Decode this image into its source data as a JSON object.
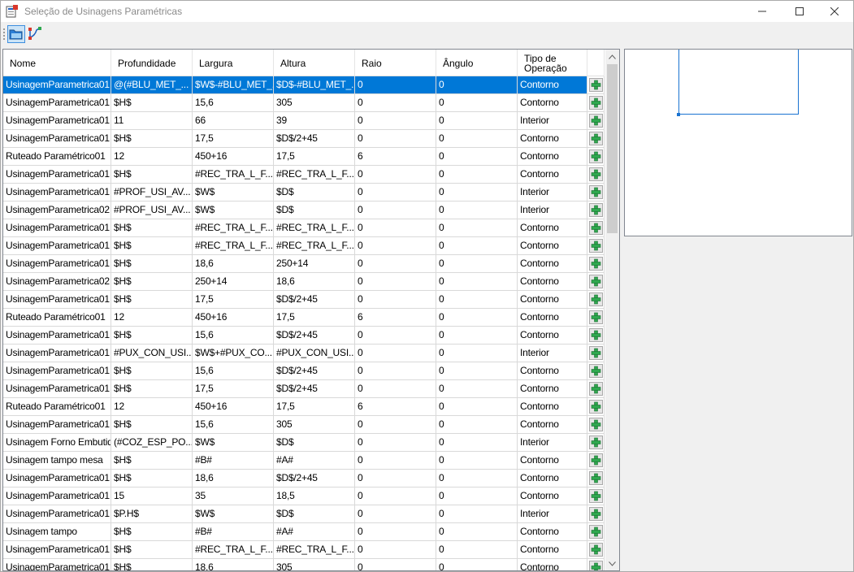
{
  "window": {
    "title": "Seleção de Usinagens Paramétricas"
  },
  "toolbar": {
    "items": [
      {
        "icon": "folder-view-icon"
      },
      {
        "icon": "path-edit-icon"
      }
    ]
  },
  "grid": {
    "columns": [
      "Nome",
      "Profundidade",
      "Largura",
      "Altura",
      "Raio",
      "Ângulo",
      "Tipo de\nOperação"
    ],
    "rows": [
      [
        "UsinagemParametrica01",
        "@(#BLU_MET_...",
        "$W$-#BLU_MET_...",
        "$D$-#BLU_MET_...",
        "0",
        "0",
        "Contorno"
      ],
      [
        "UsinagemParametrica01",
        "$H$",
        "15,6",
        "305",
        "0",
        "0",
        "Contorno"
      ],
      [
        "UsinagemParametrica01",
        "11",
        "66",
        "39",
        "0",
        "0",
        "Interior"
      ],
      [
        "UsinagemParametrica01",
        "$H$",
        "17,5",
        "$D$/2+45",
        "0",
        "0",
        "Contorno"
      ],
      [
        "Ruteado Paramétrico01",
        "12",
        "450+16",
        "17,5",
        "6",
        "0",
        "Contorno"
      ],
      [
        "UsinagemParametrica01",
        "$H$",
        "#REC_TRA_L_F...",
        "#REC_TRA_L_F...",
        "0",
        "0",
        "Contorno"
      ],
      [
        "UsinagemParametrica01",
        "#PROF_USI_AV...",
        "$W$",
        "$D$",
        "0",
        "0",
        "Interior"
      ],
      [
        "UsinagemParametrica02",
        "#PROF_USI_AV...",
        "$W$",
        "$D$",
        "0",
        "0",
        "Interior"
      ],
      [
        "UsinagemParametrica01",
        "$H$",
        "#REC_TRA_L_F...",
        "#REC_TRA_L_F...",
        "0",
        "0",
        "Contorno"
      ],
      [
        "UsinagemParametrica01",
        "$H$",
        "#REC_TRA_L_F...",
        "#REC_TRA_L_F...",
        "0",
        "0",
        "Contorno"
      ],
      [
        "UsinagemParametrica01",
        "$H$",
        "18,6",
        "250+14",
        "0",
        "0",
        "Contorno"
      ],
      [
        "UsinagemParametrica02",
        "$H$",
        "250+14",
        "18,6",
        "0",
        "0",
        "Contorno"
      ],
      [
        "UsinagemParametrica01",
        "$H$",
        "17,5",
        "$D$/2+45",
        "0",
        "0",
        "Contorno"
      ],
      [
        "Ruteado Paramétrico01",
        "12",
        "450+16",
        "17,5",
        "6",
        "0",
        "Contorno"
      ],
      [
        "UsinagemParametrica01",
        "$H$",
        "15,6",
        "$D$/2+45",
        "0",
        "0",
        "Contorno"
      ],
      [
        "UsinagemParametrica01",
        "#PUX_CON_USI...",
        "$W$+#PUX_CO...",
        "#PUX_CON_USI...",
        "0",
        "0",
        "Interior"
      ],
      [
        "UsinagemParametrica01",
        "$H$",
        "15,6",
        "$D$/2+45",
        "0",
        "0",
        "Contorno"
      ],
      [
        "UsinagemParametrica01",
        "$H$",
        "17,5",
        "$D$/2+45",
        "0",
        "0",
        "Contorno"
      ],
      [
        "Ruteado Paramétrico01",
        "12",
        "450+16",
        "17,5",
        "6",
        "0",
        "Contorno"
      ],
      [
        "UsinagemParametrica01",
        "$H$",
        "15,6",
        "305",
        "0",
        "0",
        "Contorno"
      ],
      [
        "Usinagem Forno Embutido",
        "(#COZ_ESP_PO...",
        "$W$",
        "$D$",
        "0",
        "0",
        "Interior"
      ],
      [
        "Usinagem tampo mesa",
        "$H$",
        "#B#",
        "#A#",
        "0",
        "0",
        "Contorno"
      ],
      [
        "UsinagemParametrica01",
        "$H$",
        "18,6",
        "$D$/2+45",
        "0",
        "0",
        "Contorno"
      ],
      [
        "UsinagemParametrica01",
        "15",
        "35",
        "18,5",
        "0",
        "0",
        "Contorno"
      ],
      [
        "UsinagemParametrica01",
        "$P.H$",
        "$W$",
        "$D$",
        "0",
        "0",
        "Interior"
      ],
      [
        "Usinagem tampo",
        "$H$",
        "#B#",
        "#A#",
        "0",
        "0",
        "Contorno"
      ],
      [
        "UsinagemParametrica01",
        "$H$",
        "#REC_TRA_L_F...",
        "#REC_TRA_L_F...",
        "0",
        "0",
        "Contorno"
      ],
      [
        "UsinagemParametrica01",
        "$H$",
        "18,6",
        "305",
        "0",
        "0",
        "Contorno"
      ]
    ],
    "selected_row": 0,
    "add_icon": "plus-icon",
    "add_color": "#2fa84f"
  },
  "colors": {
    "selection": "#0078d7",
    "preview_stroke": "#1a73d1"
  }
}
